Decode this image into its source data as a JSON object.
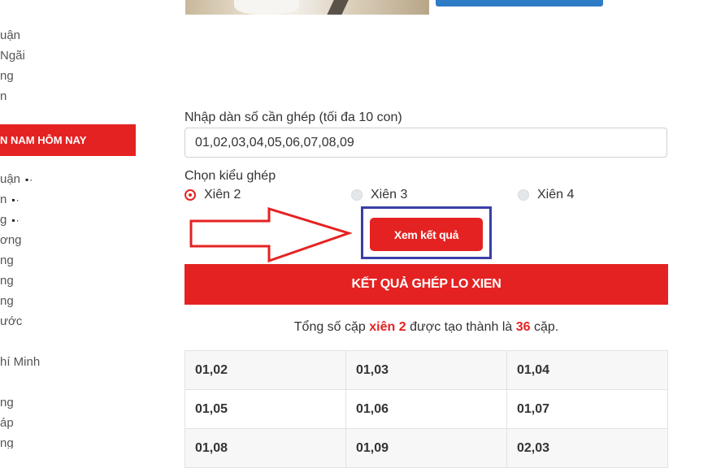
{
  "sidebar": {
    "links_top": [
      "uận",
      "Ngãi",
      "ng",
      "n"
    ],
    "header": "N NAM HÔM NAY",
    "links_bottom": [
      "uận",
      "n",
      "g",
      "ơng",
      "ng",
      "ng",
      "ng",
      "ước",
      "",
      "hí Minh",
      "",
      "ng",
      "áp",
      "ng"
    ],
    "dots": "▪·"
  },
  "form": {
    "input_label": "Nhập dàn số cần ghép (tối đa 10 con)",
    "input_value": "01,02,03,04,05,06,07,08,09",
    "type_label": "Chọn kiểu ghép",
    "options": [
      {
        "label": "Xiên 2",
        "selected": true
      },
      {
        "label": "Xiên 3",
        "selected": false
      },
      {
        "label": "Xiên 4",
        "selected": false
      }
    ],
    "submit_label": "Xem kết quả"
  },
  "result": {
    "header": "KẾT QUẢ GHÉP LO XIEN",
    "summary_prefix": "Tổng số cặp",
    "summary_type": "xiên 2",
    "summary_middle": "được tạo thành là",
    "summary_count": "36",
    "summary_suffix": "cặp.",
    "rows": [
      [
        "01,02",
        "01,03",
        "01,04"
      ],
      [
        "01,05",
        "01,06",
        "01,07"
      ],
      [
        "01,08",
        "01,09",
        "02,03"
      ]
    ]
  },
  "colors": {
    "accent": "#e52222",
    "highlight_box": "#3b3ea8",
    "top_button": "#2e7cc5"
  },
  "annotations": {
    "arrow_icon": "right-arrow-outline-icon"
  }
}
